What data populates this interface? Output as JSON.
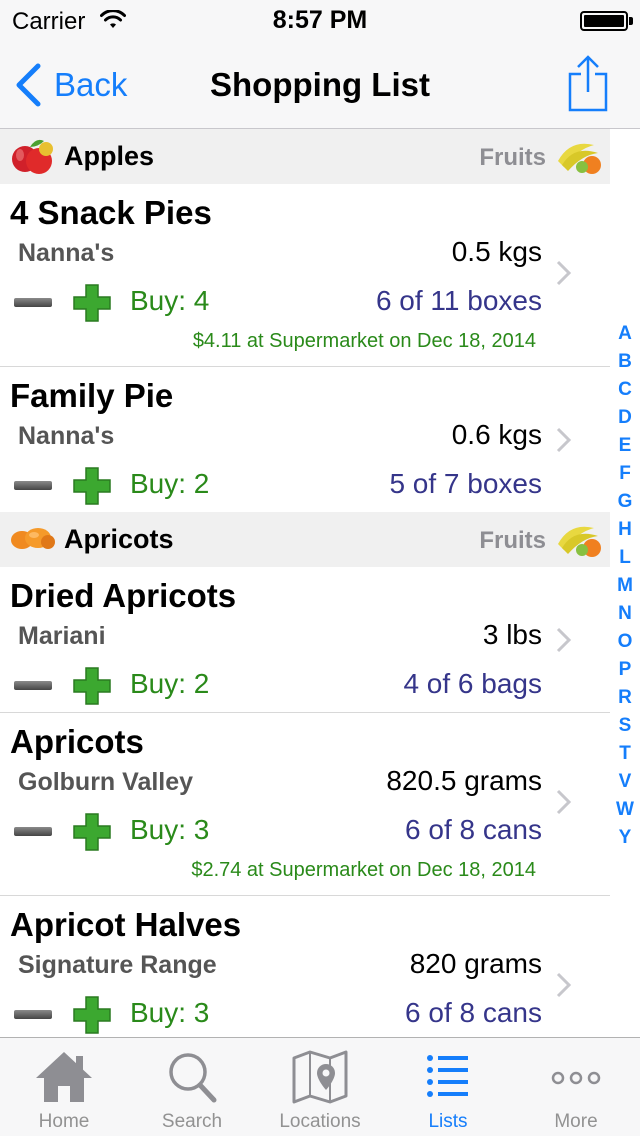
{
  "status_bar": {
    "carrier": "Carrier",
    "time": "8:57 PM"
  },
  "nav": {
    "back_label": "Back",
    "title": "Shopping List"
  },
  "sections": [
    {
      "title": "Apples",
      "category": "Fruits",
      "items": [
        {
          "name": "4 Snack Pies",
          "brand": "Nanna's",
          "size": "0.5 kgs",
          "buy": "Buy: 4",
          "stock": "6 of 11 boxes",
          "note": "$4.11 at Supermarket on Dec 18, 2014"
        },
        {
          "name": "Family Pie",
          "brand": "Nanna's",
          "size": "0.6 kgs",
          "buy": "Buy: 2",
          "stock": "5 of 7 boxes",
          "note": ""
        }
      ]
    },
    {
      "title": "Apricots",
      "category": "Fruits",
      "items": [
        {
          "name": "Dried Apricots",
          "brand": "Mariani",
          "size": "3 lbs",
          "buy": "Buy: 2",
          "stock": "4 of 6 bags",
          "note": ""
        },
        {
          "name": "Apricots",
          "brand": "Golburn Valley",
          "size": "820.5 grams",
          "buy": "Buy: 3",
          "stock": "6 of 8 cans",
          "note": "$2.74 at Supermarket on Dec 18, 2014"
        },
        {
          "name": "Apricot Halves",
          "brand": "Signature Range",
          "size": "820 grams",
          "buy": "Buy: 3",
          "stock": "6 of 8 cans",
          "note": ""
        }
      ]
    }
  ],
  "index_letters": [
    "A",
    "B",
    "C",
    "D",
    "E",
    "F",
    "G",
    "H",
    "L",
    "M",
    "N",
    "O",
    "P",
    "R",
    "S",
    "T",
    "V",
    "W",
    "Y"
  ],
  "tabs": [
    {
      "label": "Home",
      "icon": "house-icon"
    },
    {
      "label": "Search",
      "icon": "magnifier-icon"
    },
    {
      "label": "Locations",
      "icon": "map-pin-icon"
    },
    {
      "label": "Lists",
      "icon": "list-icon",
      "active": true
    },
    {
      "label": "More",
      "icon": "ellipsis-icon"
    }
  ],
  "colors": {
    "accent": "#157efb",
    "buy_green": "#2a8a1a",
    "stock_blue": "#35358a"
  }
}
